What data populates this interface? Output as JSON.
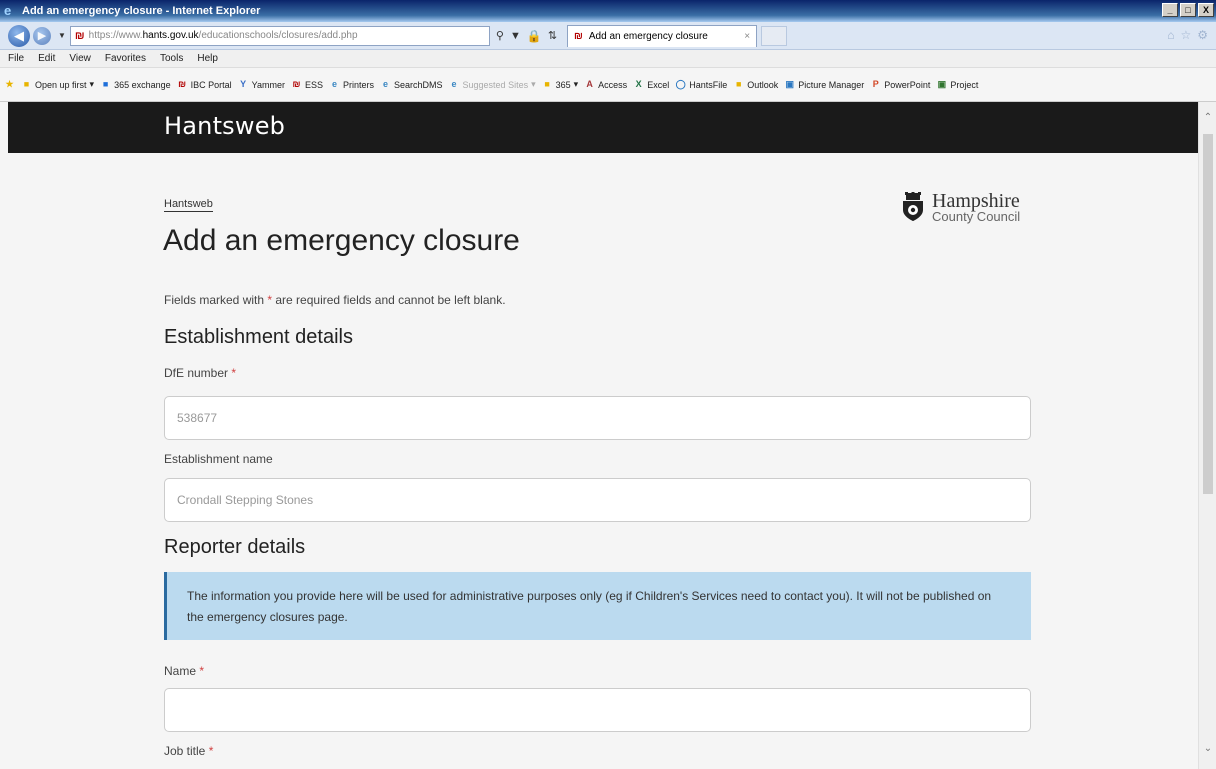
{
  "window": {
    "title": "Add an emergency closure - Internet Explorer",
    "buttons": [
      "_",
      "□",
      "X"
    ]
  },
  "browser": {
    "address": {
      "protocol": "https://",
      "domain_prefix": "www.",
      "domain": "hants.gov.uk",
      "path": "/educationschools/closures/add.php"
    },
    "tab_title": "Add an emergency closure",
    "menu": [
      "File",
      "Edit",
      "View",
      "Favorites",
      "Tools",
      "Help"
    ],
    "favorites": [
      {
        "label": "Open up first",
        "icon": "folder-icon",
        "color": "#e8b400"
      },
      {
        "label": "365 exchange",
        "icon": "exchange-icon",
        "color": "#1e6fd9"
      },
      {
        "label": "IBC Portal",
        "icon": "hcc-icon",
        "color": "#b20000"
      },
      {
        "label": "Yammer",
        "icon": "yammer-icon",
        "color": "#396ec7"
      },
      {
        "label": "ESS",
        "icon": "hcc-icon",
        "color": "#b20000"
      },
      {
        "label": "Printers",
        "icon": "page-icon",
        "color": "#3b88c3"
      },
      {
        "label": "SearchDMS",
        "icon": "page-icon",
        "color": "#3b88c3"
      },
      {
        "label": "Suggested Sites",
        "icon": "page-icon",
        "color": "#3b88c3"
      },
      {
        "label": "365",
        "icon": "folder-icon",
        "color": "#e8b400"
      },
      {
        "label": "Access",
        "icon": "access-icon",
        "color": "#a4373a"
      },
      {
        "label": "Excel",
        "icon": "excel-icon",
        "color": "#207245"
      },
      {
        "label": "HantsFile",
        "icon": "globe-icon",
        "color": "#2b78c2"
      },
      {
        "label": "Outlook",
        "icon": "outlook-icon",
        "color": "#e8b400"
      },
      {
        "label": "Picture Manager",
        "icon": "picture-icon",
        "color": "#2b78c2"
      },
      {
        "label": "PowerPoint",
        "icon": "powerpoint-icon",
        "color": "#d24726"
      },
      {
        "label": "Project",
        "icon": "project-icon",
        "color": "#31752f"
      }
    ]
  },
  "site": {
    "brand": "Hantsweb",
    "breadcrumb": "Hantsweb",
    "logo": {
      "line1": "Hampshire",
      "line2": "County Council"
    }
  },
  "page": {
    "title": "Add an emergency closure",
    "required_note": {
      "before": "Fields marked with ",
      "star": "*",
      "after": " are required fields and cannot be left blank."
    },
    "sections": {
      "establishment": "Establishment details",
      "reporter": "Reporter details"
    },
    "fields": {
      "dfe_number": {
        "label": "DfE number",
        "required": "*",
        "value": "538677"
      },
      "establishment_name": {
        "label": "Establishment name",
        "value": "Crondall Stepping Stones"
      },
      "name": {
        "label": "Name",
        "required": "*",
        "value": ""
      },
      "job_title": {
        "label": "Job title",
        "required": "*"
      }
    },
    "info": "The information you provide here will be used for administrative purposes only (eg if Children's Services need to contact you). It will not be published on the emergency closures page."
  }
}
